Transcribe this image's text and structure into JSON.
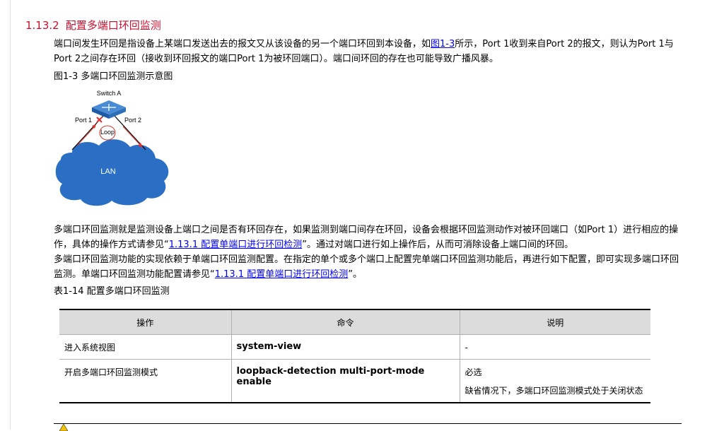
{
  "section": {
    "number": "1.13.2",
    "title": "配置多端口环回监测"
  },
  "intro": {
    "before_link": "端口间发生环回是指设备上某端口发送出去的报文又从该设备的另一个端口环回到本设备，如",
    "link": "图1-3",
    "after_link": "所示，Port 1收到来自Port 2的报文，则认为Port 1与Port 2之间存在环回（接收到环回报文的端口Port 1为被环回端口）。端口间环回的存在也可能导致广播风暴。"
  },
  "figure": {
    "caption": "图1-3 多端口环回监测示意图",
    "switch_label": "Switch A",
    "port1_label": "Port 1",
    "port2_label": "Port 2",
    "loop_label": "Loop",
    "lan_label": "LAN",
    "colors": {
      "cloud": "#2b6fc5",
      "switch": "#2d6fb8",
      "arrow": "#e0322e"
    }
  },
  "para1": {
    "before_link": "多端口环回监测就是监测设备上端口之间是否有环回存在，如果监测到端口间存在环回，设备会根据环回监测动作对被环回端口（如Port 1）进行相应的操作，具体的操作方式请参见“",
    "link": "1.13.1  配置单端口进行环回检测",
    "after_link": "”。通过对端口进行如上操作后，从而可消除设备上端口间的环回。"
  },
  "para2": {
    "before_link": "多端口环回监测功能的实现依赖于单端口环回监测配置。在指定的单个或多个端口上配置完单端口环回监测功能后，再进行如下配置，即可实现多端口环回监测。单端口环回监测功能配置请参见“",
    "link": "1.13.1  配置单端口进行环回检测",
    "after_link": "”。"
  },
  "table": {
    "caption": "表1-14 配置多端口环回监测",
    "headers": [
      "操作",
      "命令",
      "说明"
    ],
    "rows": [
      {
        "operation": "进入系统视图",
        "command": "system-view",
        "notes": [
          "-"
        ]
      },
      {
        "operation": "开启多端口环回监测模式",
        "command": "loopback-detection multi-port-mode enable",
        "notes": [
          "必选",
          "缺省情况下，多端口环回监测模式处于关闭状态"
        ]
      }
    ]
  },
  "colors": {
    "heading": "#c8102e",
    "link": "#0000ee",
    "table_header_bg": "#dcdcdc"
  }
}
